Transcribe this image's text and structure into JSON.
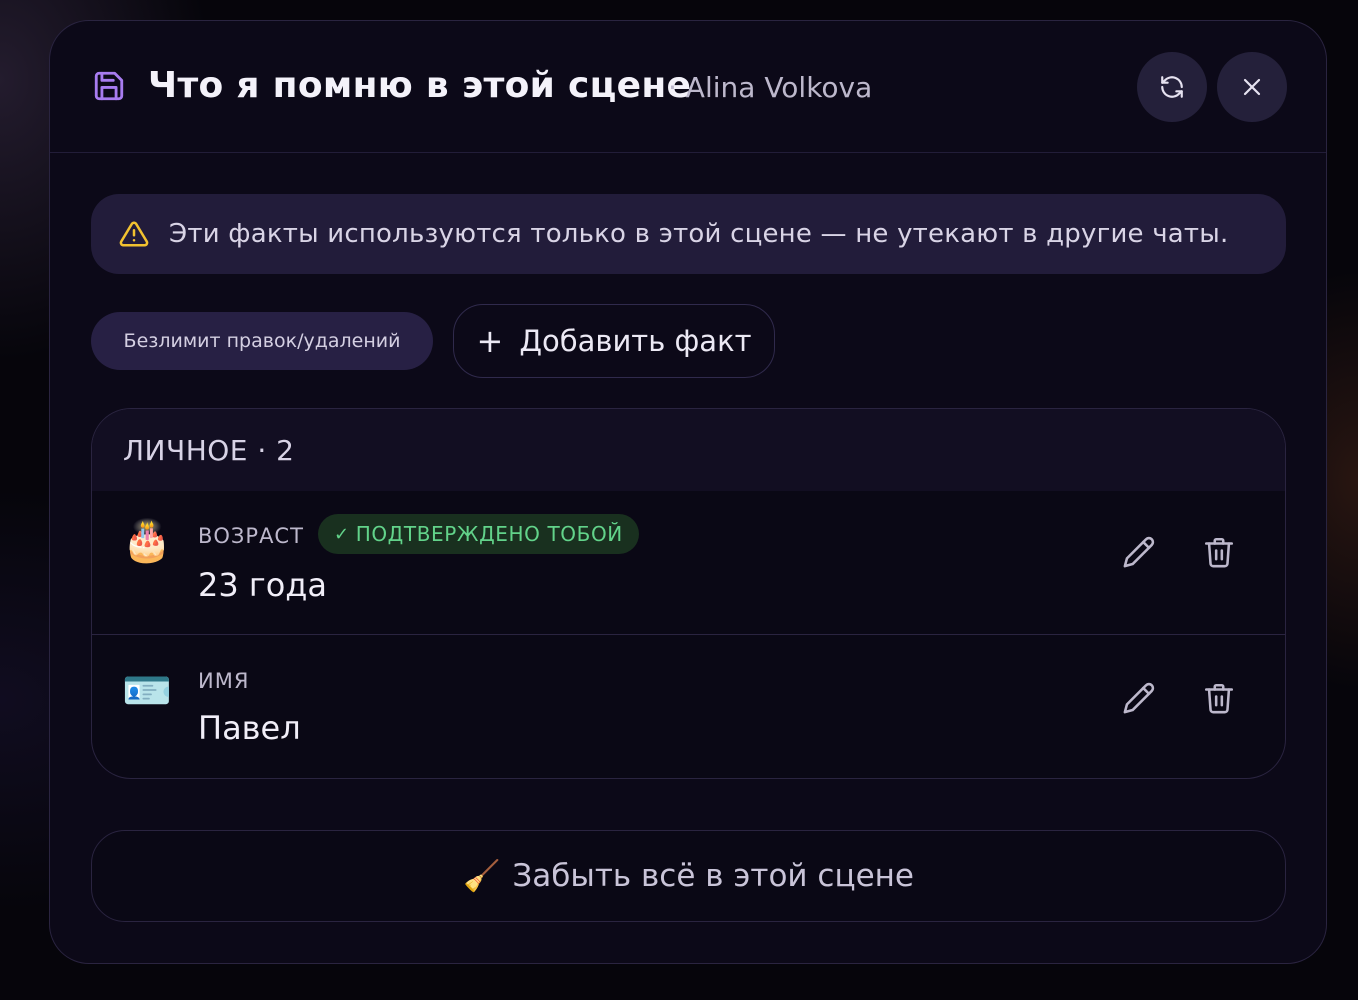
{
  "header": {
    "title": "Что я помню в этой сцене",
    "subtitle": "· Alina Volkova",
    "save_icon": "save-icon",
    "refresh_icon": "refresh-icon",
    "close_icon": "close-icon"
  },
  "notice": {
    "icon": "warning-icon",
    "text": "Эти факты используются только в этой сцене — не утекают в другие чаты."
  },
  "toolbar": {
    "limit_label": "Безлимит правок/удалений",
    "add_plus": "+",
    "add_label": "Добавить факт"
  },
  "section": {
    "heading": "ЛИЧНОЕ · 2",
    "facts": [
      {
        "emoji": "🎂",
        "label": "ВОЗРАСТ",
        "badge_check": "✓",
        "badge": "ПОДТВЕРЖДЕНО ТОБОЙ",
        "value": "23 года"
      },
      {
        "emoji": "🪪",
        "label": "ИМЯ",
        "value": "Павел"
      }
    ]
  },
  "footer": {
    "forget_emoji": "🧹",
    "forget_label": "Забыть всё в этой сцене"
  },
  "colors": {
    "accent": "#a87cf0",
    "warning": "#f2c230",
    "confirmed": "#62d38a",
    "surface": "#0c0918"
  }
}
